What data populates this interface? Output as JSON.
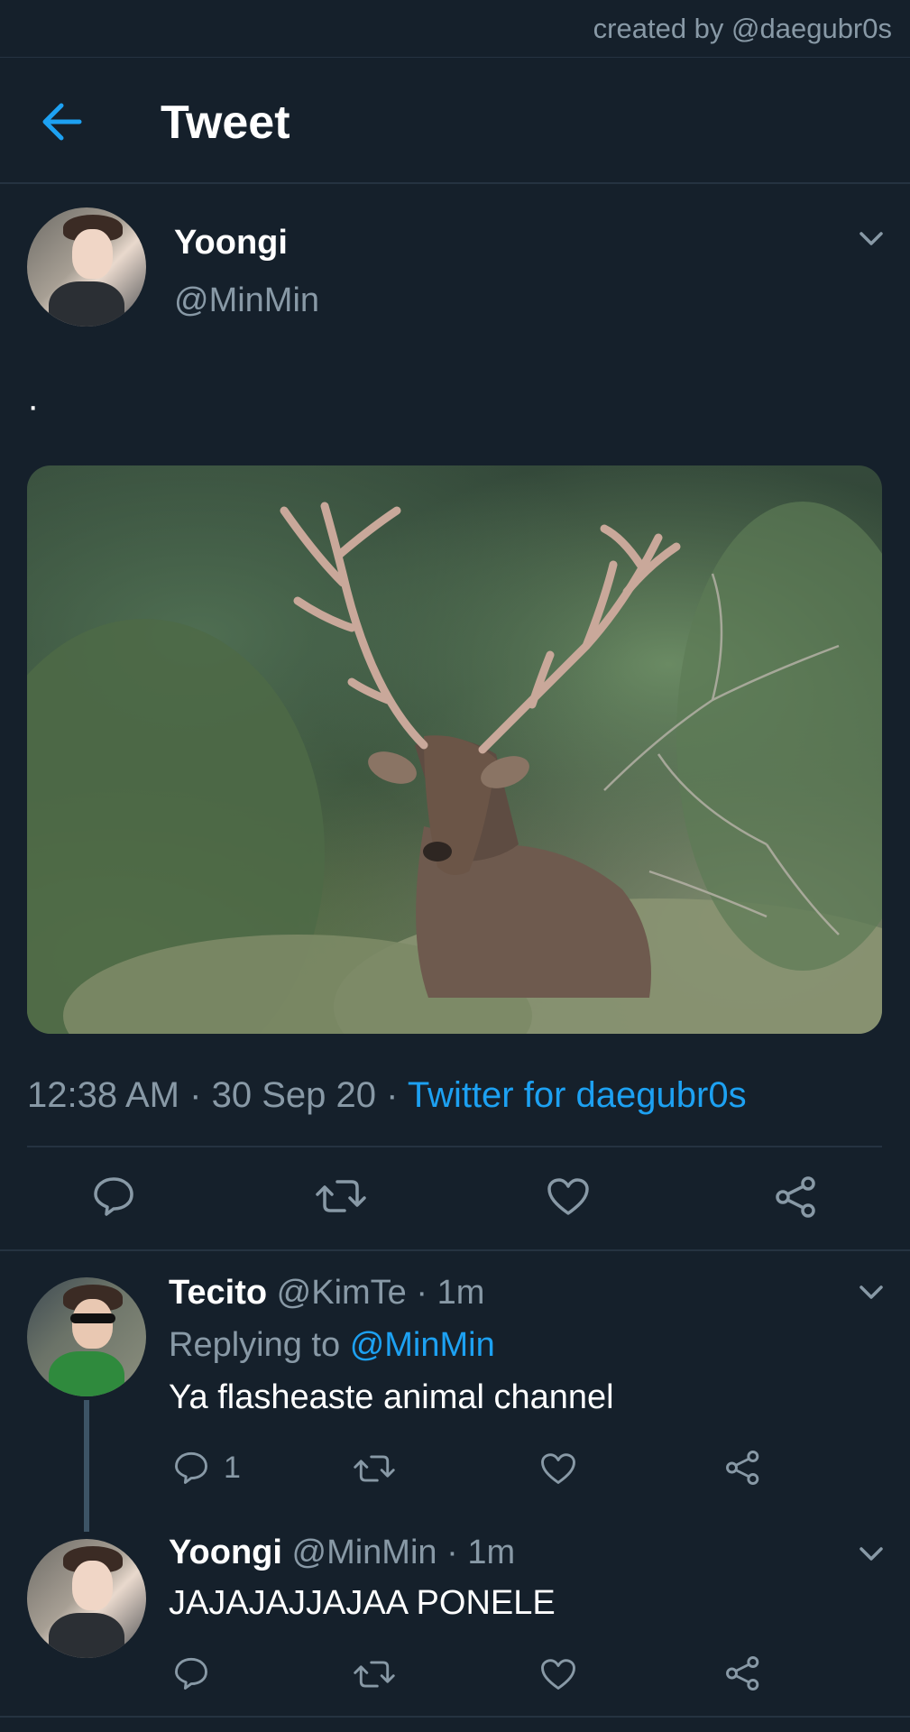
{
  "watermark": "created by @daegubr0s",
  "header": {
    "title": "Tweet"
  },
  "tweet": {
    "author_name": "Yoongi",
    "author_handle": "@MinMin",
    "text": "·",
    "time": "12:38 AM",
    "date": "30 Sep 20",
    "separator": "·",
    "source": "Twitter for daegubr0s"
  },
  "replies": [
    {
      "name": "Tecito",
      "handle": "@KimTe",
      "time": "· 1m",
      "replying_prefix": "Replying to",
      "replying_handle": "@MinMin",
      "text": "Ya flasheaste animal channel",
      "reply_count": "1"
    },
    {
      "name": "Yoongi",
      "handle": "@MinMin",
      "time": "· 1m",
      "text": "JAJAJAJJAJAA PONELE"
    }
  ],
  "colors": {
    "background": "#15202b",
    "accent": "#1da1f2",
    "muted": "#8899a6",
    "divider": "#253341"
  },
  "icons": {
    "back": "arrow-left-icon",
    "more": "chevron-down-icon",
    "reply": "speech-bubble-icon",
    "retweet": "retweet-icon",
    "like": "heart-icon",
    "share": "share-icon"
  }
}
